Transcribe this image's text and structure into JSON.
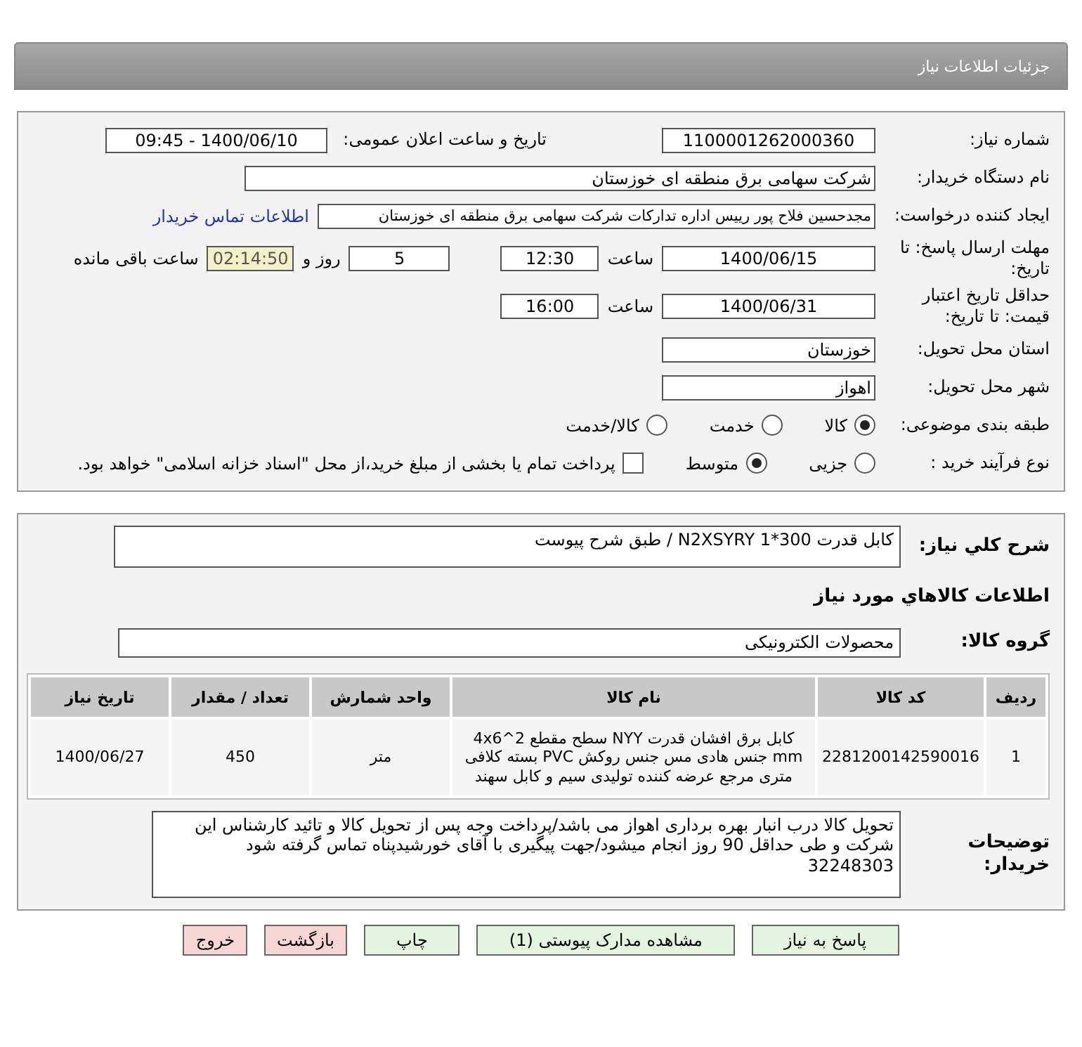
{
  "header": {
    "title": "جزئیات اطلاعات نیاز"
  },
  "need_number": {
    "label": "شماره نیاز:",
    "value": "1100001262000360"
  },
  "announce": {
    "label": "تاریخ و ساعت اعلان عمومی:",
    "value": "1400/06/10 - 09:45"
  },
  "buyer": {
    "label": "نام دستگاه خریدار:",
    "value": "شرکت سهامی برق منطقه ای خوزستان"
  },
  "requester": {
    "label": "ایجاد کننده درخواست:",
    "value": "مجدحسین فلاح پور رییس اداره تدارکات شرکت سهامی برق منطقه ای خوزستان",
    "link": "اطلاعات تماس خریدار"
  },
  "deadline": {
    "label": "مهلت ارسال پاسخ: تا تاریخ:",
    "date": "1400/06/15",
    "time_label": "ساعت",
    "time": "12:30",
    "days": "5",
    "days_label": "روز و",
    "remaining": "02:14:50",
    "remaining_label": "ساعت باقی مانده"
  },
  "validity": {
    "label": "حداقل تاریخ اعتبار قیمت: تا تاریخ:",
    "date": "1400/06/31",
    "time_label": "ساعت",
    "time": "16:00"
  },
  "province": {
    "label": "استان محل تحویل:",
    "value": "خوزستان"
  },
  "city": {
    "label": "شهر محل تحویل:",
    "value": "اهواز"
  },
  "category": {
    "label": "طبقه بندی موضوعی:",
    "options": [
      {
        "label": "کالا",
        "selected": true
      },
      {
        "label": "خدمت",
        "selected": false
      },
      {
        "label": "کالا/خدمت",
        "selected": false
      }
    ]
  },
  "process": {
    "label": "نوع فرآیند خرید :",
    "options": [
      {
        "label": "جزیی",
        "selected": false
      },
      {
        "label": "متوسط",
        "selected": true
      }
    ],
    "treasury": {
      "checked": false,
      "text": "پرداخت تمام یا بخشی از مبلغ خرید،از محل \"اسناد خزانه اسلامی\" خواهد بود."
    }
  },
  "description": {
    "label": "شرح کلي نياز:",
    "value": "کابل قدرت N2XSYRY  1*300 / طبق شرح پیوست"
  },
  "goods_heading": "اطلاعات کالاهاي مورد نياز",
  "group": {
    "label": "گروه کالا:",
    "value": "محصولات الکترونیکی"
  },
  "table": {
    "columns": [
      "ردیف",
      "کد کالا",
      "نام کالا",
      "واحد شمارش",
      "تعداد / مقدار",
      "تاریخ نیاز"
    ],
    "rows": [
      [
        "1",
        "2281200142590016",
        "کابل برق افشان قدرت NYY سطح مقطع 2^4x6 mm جنس هادی مس جنس روکش PVC بسته کلافی متری مرجع عرضه کننده تولیدی سیم و کابل سهند",
        "متر",
        "450",
        "1400/06/27"
      ]
    ]
  },
  "buyer_notes": {
    "label": "توضیحات خریدار:",
    "value": "تحویل کالا درب انبار بهره برداری اهواز می باشد/پرداخت وجه پس از تحویل کالا و تائید کارشناس این شرکت و طی حداقل 90 روز انجام میشود/جهت پیگیری با آقای خورشیدپناه تماس گرفته شود 32248303"
  },
  "buttons": [
    {
      "label": "پاسخ به نیاز",
      "kind": "action"
    },
    {
      "label": "مشاهده مدارک پیوستی (1)",
      "kind": "action"
    },
    {
      "label": "چاپ",
      "kind": "action"
    },
    {
      "label": "بازگشت",
      "kind": "exit"
    },
    {
      "label": "خروج",
      "kind": "exit"
    }
  ]
}
